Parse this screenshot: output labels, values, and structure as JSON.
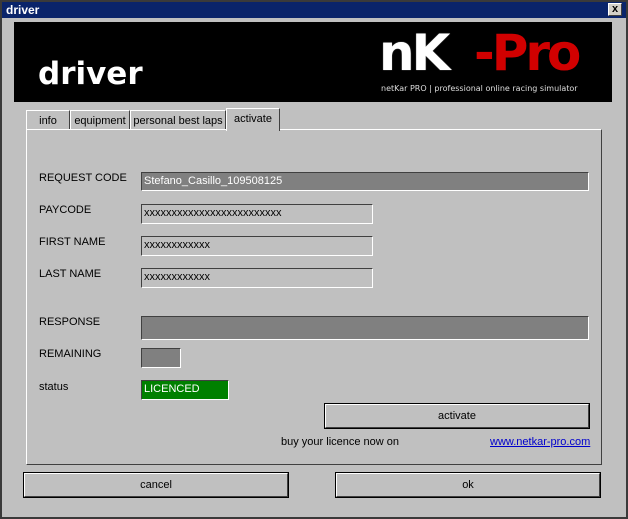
{
  "window": {
    "title": "driver",
    "close_label": "x"
  },
  "banner": {
    "title": "driver",
    "logo_nk": "nK",
    "logo_pro": "-Pro",
    "logo_sub": "netKar PRO | professional online racing simulator"
  },
  "tabs": [
    {
      "label": "info"
    },
    {
      "label": "equipment"
    },
    {
      "label": "personal best laps"
    },
    {
      "label": "activate",
      "active": true
    }
  ],
  "form": {
    "request_code": {
      "label": "REQUEST CODE",
      "value": "Stefano_Casillo_109508125"
    },
    "paycode": {
      "label": "PAYCODE",
      "value": "xxxxxxxxxxxxxxxxxxxxxxxxx"
    },
    "first_name": {
      "label": "FIRST NAME",
      "value": "xxxxxxxxxxxx"
    },
    "last_name": {
      "label": "LAST NAME",
      "value": "xxxxxxxxxxxx"
    },
    "response": {
      "label": "RESPONSE",
      "value": ""
    },
    "remaining": {
      "label": "REMAINING",
      "value": ""
    },
    "status": {
      "label": "status",
      "value": "LICENCED"
    }
  },
  "activate_button": "activate",
  "buy_text": "buy your licence now on",
  "buy_link": "www.netkar-pro.com",
  "footer": {
    "cancel": "cancel",
    "ok": "ok"
  },
  "colors": {
    "status_ok": "#008000",
    "logo_red": "#d10000",
    "link": "#0000cc"
  }
}
